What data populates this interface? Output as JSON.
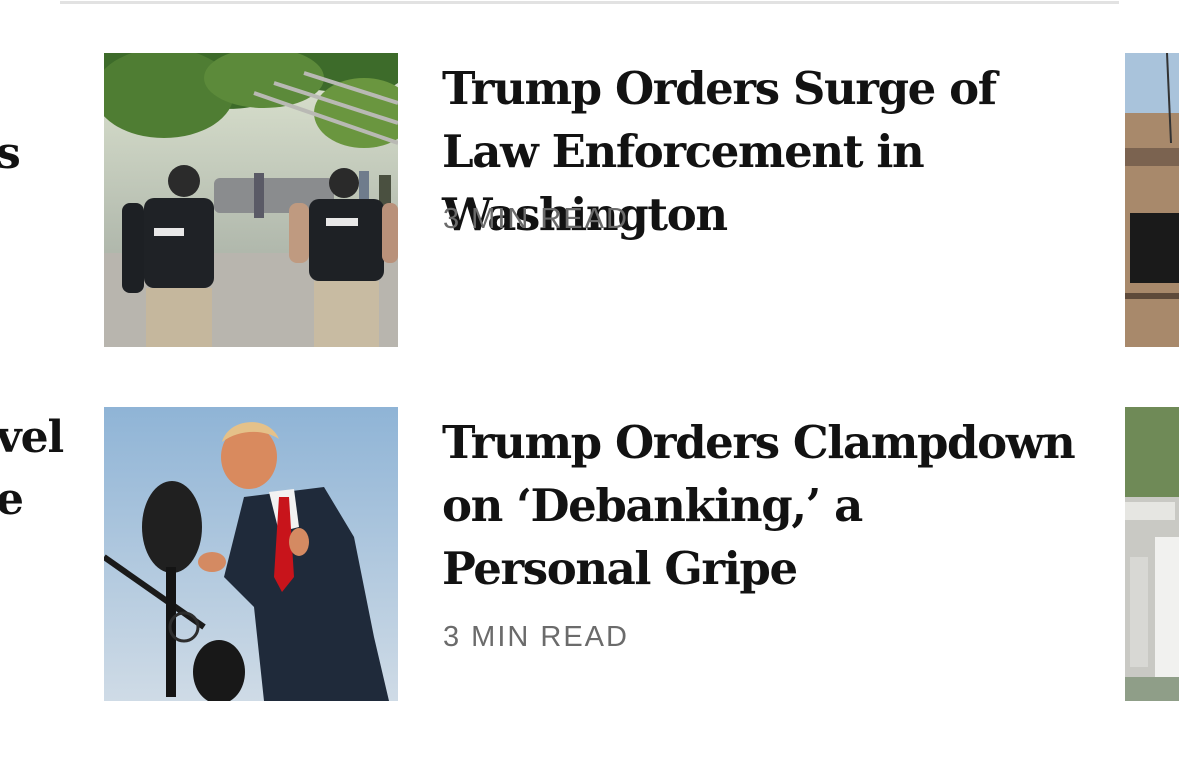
{
  "left_fragments": [
    "s",
    "vel",
    "e"
  ],
  "articles": [
    {
      "headline": "Trump Orders Surge of Law Enforcement in Washington",
      "read_time": "3 MIN READ",
      "image": "photo-officers-police-vests-metro-station"
    },
    {
      "headline": "Trump Orders Clampdown on ‘Debanking,’ a Personal Gripe",
      "read_time": "3 MIN READ",
      "image": "photo-trump-speaking-microphone"
    }
  ],
  "right_peek": [
    "photo-building-balconies",
    "photo-aerial-facility"
  ]
}
